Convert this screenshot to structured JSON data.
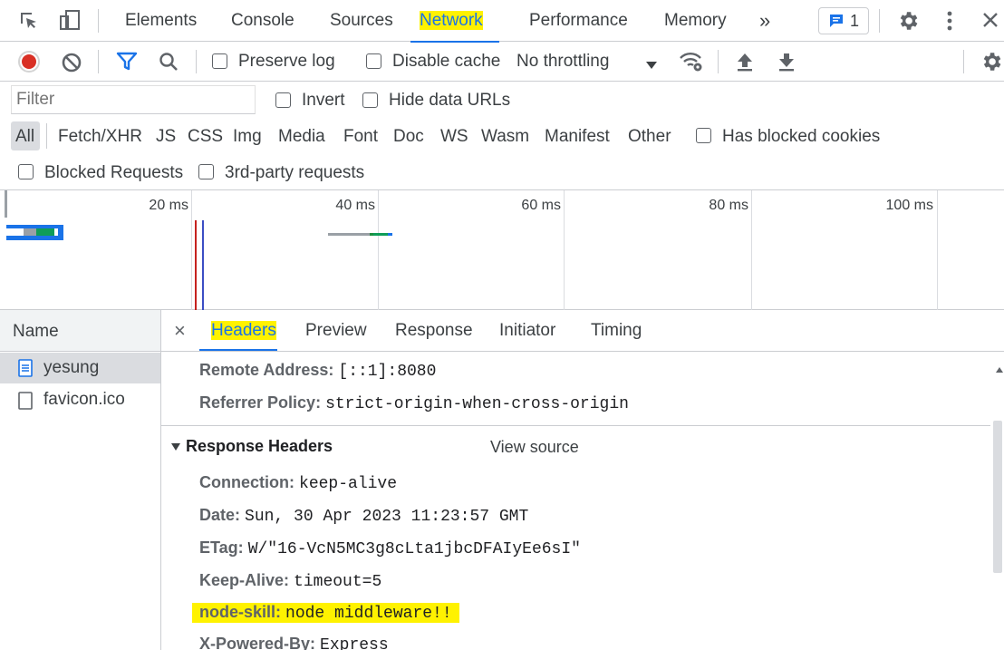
{
  "tabs": {
    "elements": "Elements",
    "console": "Console",
    "sources": "Sources",
    "network": "Network",
    "performance": "Performance",
    "memory": "Memory",
    "more": "»",
    "issues_count": "1"
  },
  "toolbar": {
    "preserve_log": "Preserve log",
    "disable_cache": "Disable cache",
    "throttling": "No throttling"
  },
  "filters": {
    "placeholder": "Filter",
    "invert": "Invert",
    "hide_data_urls": "Hide data URLs",
    "types": [
      "All",
      "Fetch/XHR",
      "JS",
      "CSS",
      "Img",
      "Media",
      "Font",
      "Doc",
      "WS",
      "Wasm",
      "Manifest",
      "Other"
    ],
    "has_blocked_cookies": "Has blocked cookies",
    "blocked_requests": "Blocked Requests",
    "third_party": "3rd-party requests"
  },
  "timeline": {
    "ticks": [
      "20 ms",
      "40 ms",
      "60 ms",
      "80 ms",
      "100 ms"
    ]
  },
  "requests": {
    "header": "Name",
    "items": [
      "yesung",
      "favicon.ico"
    ]
  },
  "detail": {
    "close": "×",
    "tabs": [
      "Headers",
      "Preview",
      "Response",
      "Initiator",
      "Timing"
    ],
    "general": [
      {
        "key": "Remote Address:",
        "value": "[::1]:8080"
      },
      {
        "key": "Referrer Policy:",
        "value": "strict-origin-when-cross-origin"
      }
    ],
    "response_headers_title": "Response Headers",
    "view_source": "View source",
    "response_headers": [
      {
        "key": "Connection:",
        "value": "keep-alive"
      },
      {
        "key": "Date:",
        "value": "Sun, 30 Apr 2023 11:23:57 GMT"
      },
      {
        "key": "ETag:",
        "value": "W/\"16-VcN5MC3g8cLta1jbcDFAIyEe6sI\""
      },
      {
        "key": "Keep-Alive:",
        "value": "timeout=5"
      },
      {
        "key": "node-skill:",
        "value": "node middleware!!"
      },
      {
        "key": "X-Powered-By:",
        "value": "Express"
      }
    ]
  },
  "colors": {
    "accent": "#1a73e8",
    "record": "#d93025",
    "highlight": "#fff200"
  }
}
